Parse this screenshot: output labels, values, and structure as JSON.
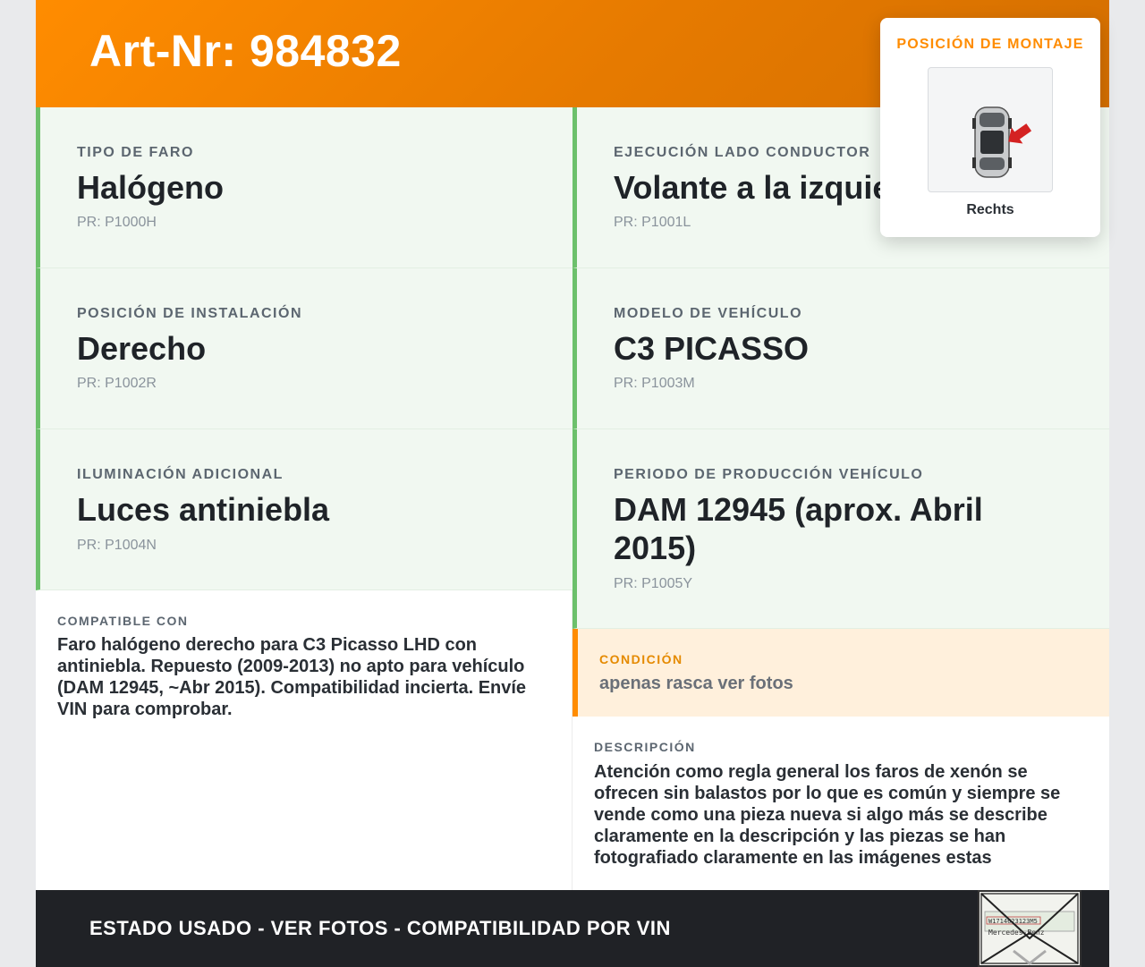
{
  "header": {
    "title": "Art-Nr: 984832"
  },
  "cells": [
    {
      "label": "TIPO DE FARO",
      "value": "Halógeno",
      "pr": "PR: P1000H"
    },
    {
      "label": "EJECUCIÓN LADO CONDUCTOR",
      "value": "Volante a la izquierda",
      "pr": "PR: P1001L"
    },
    {
      "label": "POSICIÓN DE INSTALACIÓN",
      "value": "Derecho",
      "pr": "PR: P1002R"
    },
    {
      "label": "MODELO DE VEHÍCULO",
      "value": "C3 PICASSO",
      "pr": "PR: P1003M"
    },
    {
      "label": "ILUMINACIÓN ADICIONAL",
      "value": "Luces antiniebla",
      "pr": "PR: P1004N"
    },
    {
      "label": "PERIODO DE PRODUCCIÓN VEHÍCULO",
      "value": "DAM 12945 (aprox. Abril 2015)",
      "pr": "PR: P1005Y"
    }
  ],
  "compat": {
    "title": "COMPATIBLE CON",
    "text": "Faro halógeno derecho para C3 Picasso LHD con antiniebla. Repuesto (2009-2013) no apto para vehículo (DAM 12945, ~Abr 2015). Compatibilidad incierta. Envíe VIN para comprobar."
  },
  "condition": {
    "title": "CONDICIÓN",
    "text": "apenas rasca ver fotos"
  },
  "description": {
    "title": "DESCRIPCIÓN",
    "text": "Atención como regla general los faros de xenón se ofrecen sin balastos por lo que es común y siempre se vende como una pieza nueva si algo más se describe claramente en la descripción y las piezas se han fotografiado claramente en las imágenes estas"
  },
  "footer": {
    "text": "ESTADO USADO - VER FOTOS - COMPATIBILIDAD POR VIN",
    "stamp_text_top": "W1714623123M5",
    "stamp_text_bottom": "Mercedes-Benz"
  },
  "popup": {
    "title": "POSICIÓN DE MONTAJE",
    "label": "Rechts",
    "icon": "car-top-view-icon"
  },
  "colors": {
    "accent": "#ff8c00",
    "green_border": "#6cc06b",
    "cell_bg": "#f1f8f1",
    "footer_bg": "#202226"
  }
}
